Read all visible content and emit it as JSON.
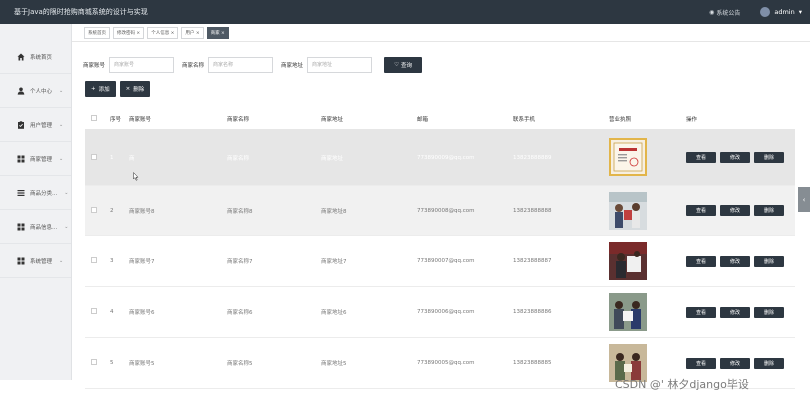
{
  "header": {
    "title": "基于Java的限时抢购商城系统的设计与实现",
    "notice": "系统公告",
    "username": "admin"
  },
  "sidebar": {
    "items": [
      {
        "label": "系统首页",
        "icon": "home-icon",
        "arrow": ""
      },
      {
        "label": "个人中心",
        "icon": "user-icon",
        "arrow": "⌄"
      },
      {
        "label": "用户管理",
        "icon": "clipboard-icon",
        "arrow": "⌄"
      },
      {
        "label": "商家管理",
        "icon": "grid-icon",
        "arrow": "⌄"
      },
      {
        "label": "商品分类...",
        "icon": "list-icon",
        "arrow": "⌄"
      },
      {
        "label": "商品信息...",
        "icon": "grid-icon",
        "arrow": "⌄"
      },
      {
        "label": "系统管理",
        "icon": "grid-icon",
        "arrow": "⌄"
      }
    ]
  },
  "tabs": [
    {
      "label": "系统首页",
      "active": false
    },
    {
      "label": "修改密码 ×",
      "active": false
    },
    {
      "label": "个人信息 ×",
      "active": false
    },
    {
      "label": "用户 ×",
      "active": false
    },
    {
      "label": "商家 ×",
      "active": true
    }
  ],
  "search": {
    "fields": [
      {
        "label": "商家账号",
        "placeholder": "商家账号"
      },
      {
        "label": "商家名称",
        "placeholder": "商家名称"
      },
      {
        "label": "商家地址",
        "placeholder": "商家地址"
      }
    ],
    "query_label": "查询"
  },
  "toolbar": {
    "add_label": "添加",
    "delete_label": "删除"
  },
  "table": {
    "columns": [
      "序号",
      "商家账号",
      "商家名称",
      "商家地址",
      "邮箱",
      "联系手机",
      "营业执照",
      "操作"
    ],
    "rows": [
      {
        "index": "1",
        "account": "商",
        "name": "商家名称",
        "address": "商家地址",
        "email": "773890009@qq.com",
        "phone": "13823888889"
      },
      {
        "index": "2",
        "account": "商家账号8",
        "name": "商家名称8",
        "address": "商家地址8",
        "email": "773890008@qq.com",
        "phone": "13823888888"
      },
      {
        "index": "3",
        "account": "商家账号7",
        "name": "商家名称7",
        "address": "商家地址7",
        "email": "773890007@qq.com",
        "phone": "13823888887"
      },
      {
        "index": "4",
        "account": "商家账号6",
        "name": "商家名称6",
        "address": "商家地址6",
        "email": "773890006@qq.com",
        "phone": "13823888886"
      },
      {
        "index": "5",
        "account": "商家账号5",
        "name": "商家名称5",
        "address": "商家地址5",
        "email": "773890005@qq.com",
        "phone": "13823888885"
      }
    ],
    "row_actions": [
      "查看",
      "修改",
      "删除"
    ]
  },
  "watermark": "CSDN @' 林夕django毕设",
  "colors": {
    "dark": "#2d3741",
    "accent_gold": "#e2b54a"
  }
}
